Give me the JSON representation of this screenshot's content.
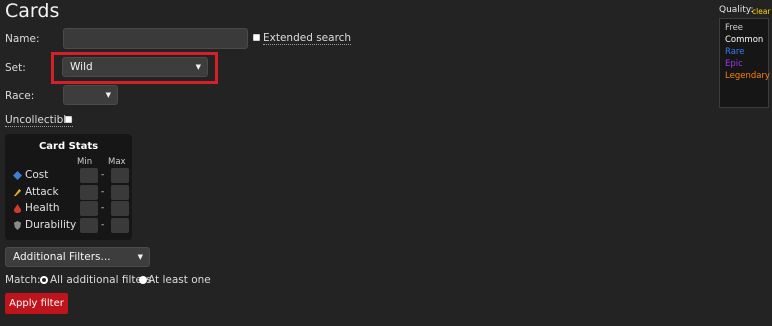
{
  "page": {
    "title": "Cards"
  },
  "form": {
    "name_label": "Name:",
    "name_value": "",
    "extended_search_label": "Extended search",
    "set_label": "Set:",
    "set_value": "Wild",
    "race_label": "Race:",
    "race_value": "",
    "uncollectible_label": "Uncollectible"
  },
  "card_stats": {
    "title": "Card Stats",
    "min_label": "Min",
    "max_label": "Max",
    "rows": [
      {
        "label": "Cost",
        "icon": "mana-crystal-icon"
      },
      {
        "label": "Attack",
        "icon": "sword-icon"
      },
      {
        "label": "Health",
        "icon": "blood-drop-icon"
      },
      {
        "label": "Durability",
        "icon": "shield-icon"
      }
    ],
    "dash": "-"
  },
  "additional_filters": {
    "label": "Additional Filters..."
  },
  "match": {
    "label": "Match:",
    "option_all": "All additional filters",
    "option_one": "At least one"
  },
  "apply_button": "Apply filter",
  "quality": {
    "label": "Quality:",
    "clear": "clear",
    "items": [
      {
        "label": "Free",
        "color": "#cfcfcf"
      },
      {
        "label": "Common",
        "color": "#ffffff"
      },
      {
        "label": "Rare",
        "color": "#2f7df6"
      },
      {
        "label": "Epic",
        "color": "#a335ee"
      },
      {
        "label": "Legendary",
        "color": "#ff8000"
      }
    ]
  },
  "colors": {
    "background": "#232323",
    "highlight": "#d42028",
    "apply_button": "#c0141c",
    "clear_link": "#ffd700"
  }
}
